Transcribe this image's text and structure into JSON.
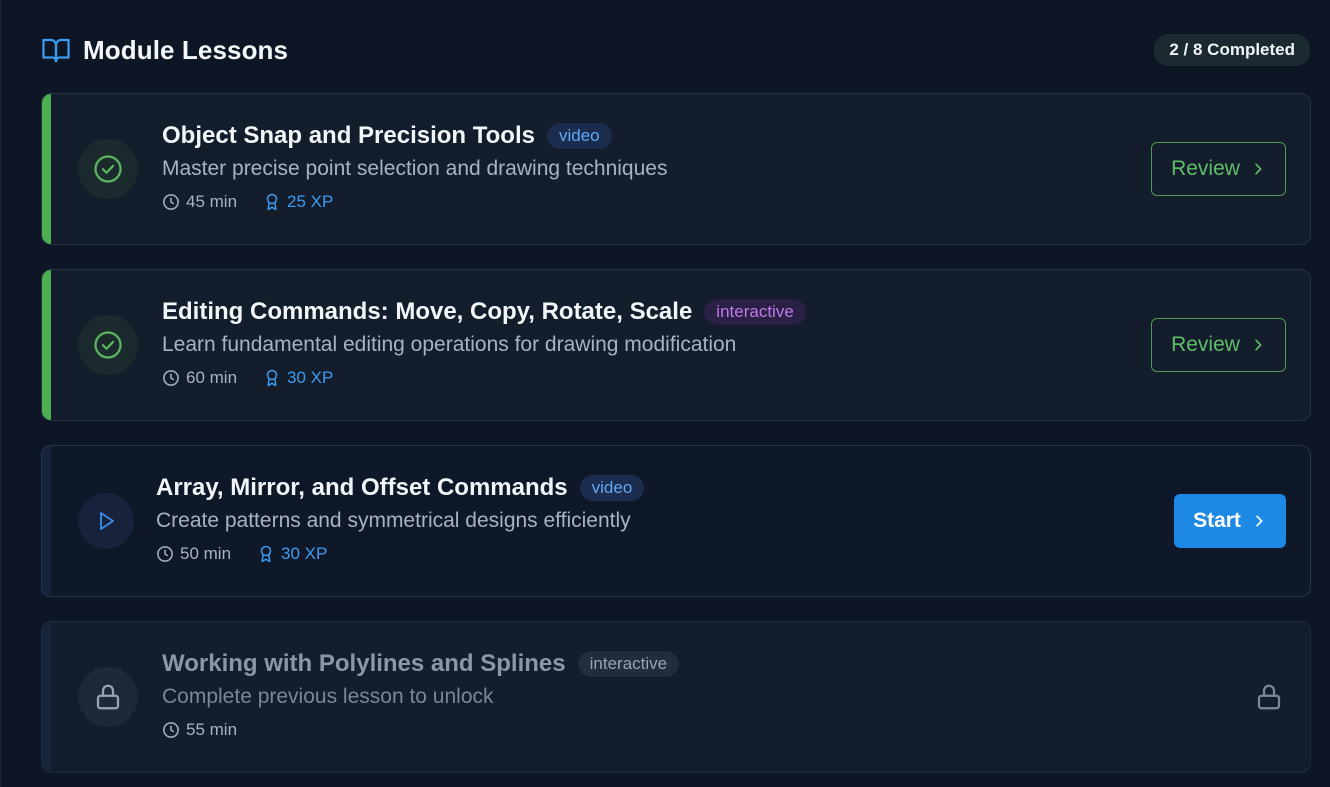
{
  "header": {
    "title": "Module Lessons",
    "icon": "book-open-icon",
    "progress_badge": "2 / 8 Completed"
  },
  "colors": {
    "completed_accent": "#4caf50",
    "primary_button": "#1e88e5",
    "xp_text": "#3c9cf0",
    "video_badge": "#5fa8f5",
    "interactive_badge": "#c07ae8"
  },
  "lessons": [
    {
      "title": "Object Snap and Precision Tools",
      "type": "video",
      "description": "Master precise point selection and drawing techniques",
      "duration": "45 min",
      "xp": "25 XP",
      "status": "completed",
      "action": "Review"
    },
    {
      "title": "Editing Commands: Move, Copy, Rotate, Scale",
      "type": "interactive",
      "description": "Learn fundamental editing operations for drawing modification",
      "duration": "60 min",
      "xp": "30 XP",
      "status": "completed",
      "action": "Review"
    },
    {
      "title": "Array, Mirror, and Offset Commands",
      "type": "video",
      "description": "Create patterns and symmetrical designs efficiently",
      "duration": "50 min",
      "xp": "30 XP",
      "status": "current",
      "action": "Start"
    },
    {
      "title": "Working with Polylines and Splines",
      "type": "interactive",
      "description": "Complete previous lesson to unlock",
      "duration": "55 min",
      "status": "locked"
    }
  ]
}
